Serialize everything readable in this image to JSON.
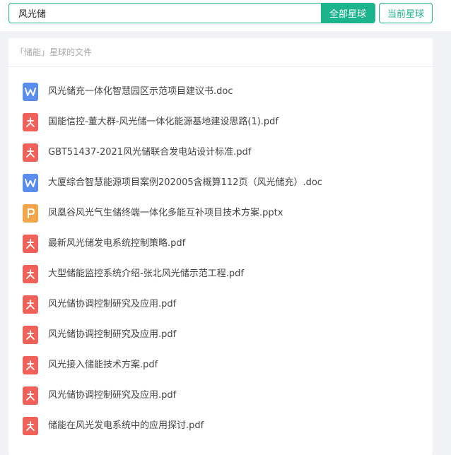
{
  "search": {
    "query": "风光储",
    "all_planets_label": "全部星球",
    "current_planet_label": "当前星球"
  },
  "panel": {
    "title": "「储能」星球的文件"
  },
  "files": [
    {
      "name": "风光储充一体化智慧园区示范项目建议书.doc",
      "type": "doc",
      "icon": "word-icon"
    },
    {
      "name": "国能信控-董大群-风光储一体化能源基地建设思路(1).pdf",
      "type": "pdf",
      "icon": "pdf-icon"
    },
    {
      "name": "GBT51437-2021风光储联合发电站设计标准.pdf",
      "type": "pdf",
      "icon": "pdf-icon"
    },
    {
      "name": "大厦综合智慧能源项目案例202005含概算112页（风光储充）.doc",
      "type": "doc",
      "icon": "word-icon"
    },
    {
      "name": "凤凰谷风光气生储终端一体化多能互补项目技术方案.pptx",
      "type": "pptx",
      "icon": "ppt-icon"
    },
    {
      "name": "最新风光储发电系统控制策略.pdf",
      "type": "pdf",
      "icon": "pdf-icon"
    },
    {
      "name": "大型储能监控系统介绍-张北风光储示范工程.pdf",
      "type": "pdf",
      "icon": "pdf-icon"
    },
    {
      "name": "风光储协调控制研究及应用.pdf",
      "type": "pdf",
      "icon": "pdf-icon"
    },
    {
      "name": "风光储协调控制研究及应用.pdf",
      "type": "pdf",
      "icon": "pdf-icon"
    },
    {
      "name": "风光接入储能技术方案.pdf",
      "type": "pdf",
      "icon": "pdf-icon"
    },
    {
      "name": "风光储协调控制研究及应用.pdf",
      "type": "pdf",
      "icon": "pdf-icon"
    },
    {
      "name": "储能在风光发电系统中的应用探讨.pdf",
      "type": "pdf",
      "icon": "pdf-icon"
    }
  ],
  "colors": {
    "accent": "#1cb48c",
    "doc": "#5b8def",
    "pdf": "#f0615a",
    "pptx": "#f2a54a"
  }
}
